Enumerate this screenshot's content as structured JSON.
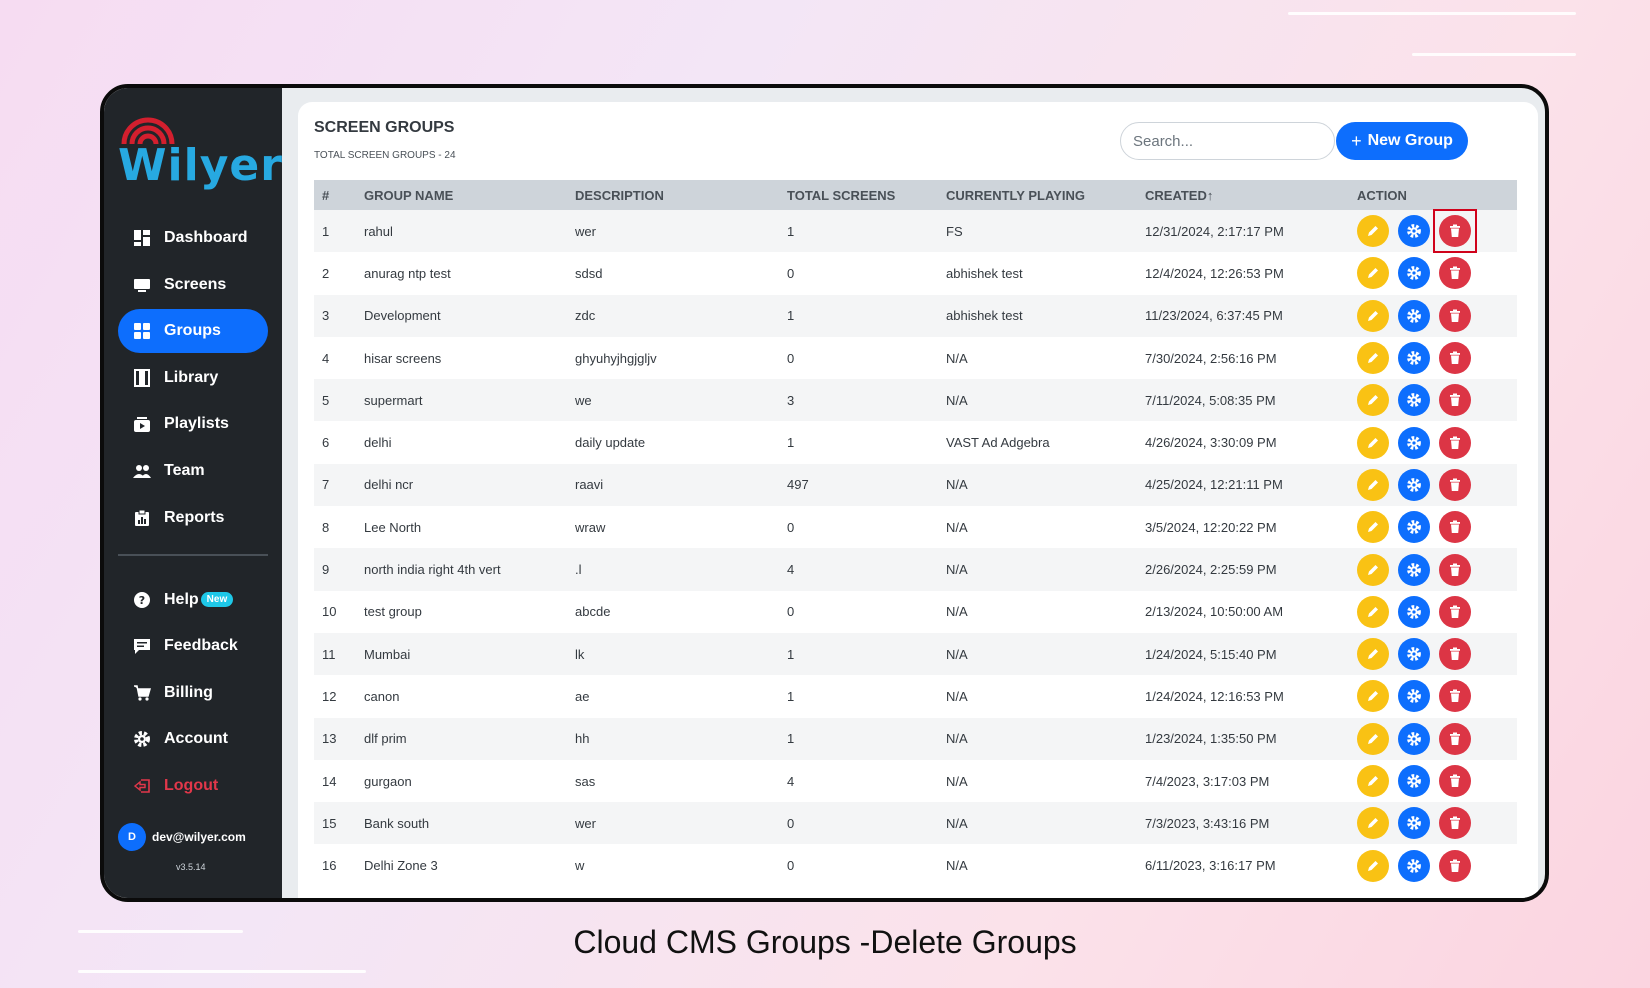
{
  "brand": {
    "name": "Wilyer",
    "logo_color": "#27a9e1",
    "signal_color": "#d31f2e"
  },
  "sidebar": {
    "items": [
      {
        "label": "Dashboard",
        "icon": "dashboard-icon",
        "active": false
      },
      {
        "label": "Screens",
        "icon": "monitor-icon",
        "active": false
      },
      {
        "label": "Groups",
        "icon": "grid-icon",
        "active": true
      },
      {
        "label": "Library",
        "icon": "film-icon",
        "active": false
      },
      {
        "label": "Playlists",
        "icon": "playlist-icon",
        "active": false
      },
      {
        "label": "Team",
        "icon": "team-icon",
        "active": false
      },
      {
        "label": "Reports",
        "icon": "clipboard-icon",
        "active": false
      }
    ],
    "secondary": [
      {
        "label": "Help",
        "icon": "help-icon",
        "badge": "New"
      },
      {
        "label": "Feedback",
        "icon": "feedback-icon"
      },
      {
        "label": "Billing",
        "icon": "cart-icon"
      },
      {
        "label": "Account",
        "icon": "gear-icon"
      },
      {
        "label": "Logout",
        "icon": "logout-icon"
      }
    ],
    "user": {
      "initial": "D",
      "email": "dev@wilyer.com"
    },
    "version": "v3.5.14"
  },
  "main": {
    "title": "SCREEN GROUPS",
    "subtitle": "TOTAL SCREEN GROUPS - 24",
    "search_placeholder": "Search...",
    "new_group_label": "New Group",
    "columns": [
      "#",
      "GROUP NAME",
      "DESCRIPTION",
      "TOTAL SCREENS",
      "CURRENTLY PLAYING",
      "CREATED",
      "ACTION"
    ],
    "sort_indicator": "↑",
    "rows": [
      {
        "num": "1",
        "name": "rahul",
        "desc": "wer",
        "total": "1",
        "playing": "FS",
        "created": "12/31/2024, 2:17:17 PM"
      },
      {
        "num": "2",
        "name": "anurag ntp test",
        "desc": "sdsd",
        "total": "0",
        "playing": "abhishek test",
        "created": "12/4/2024, 12:26:53 PM"
      },
      {
        "num": "3",
        "name": "Development",
        "desc": "zdc",
        "total": "1",
        "playing": "abhishek test",
        "created": "11/23/2024, 6:37:45 PM"
      },
      {
        "num": "4",
        "name": "hisar screens",
        "desc": "ghyuhyjhgjgljv",
        "total": "0",
        "playing": "N/A",
        "created": "7/30/2024, 2:56:16 PM"
      },
      {
        "num": "5",
        "name": "supermart",
        "desc": "we",
        "total": "3",
        "playing": "N/A",
        "created": "7/11/2024, 5:08:35 PM"
      },
      {
        "num": "6",
        "name": "delhi",
        "desc": "daily update",
        "total": "1",
        "playing": "VAST Ad Adgebra",
        "created": "4/26/2024, 3:30:09 PM"
      },
      {
        "num": "7",
        "name": "delhi ncr",
        "desc": "raavi",
        "total": "497",
        "playing": "N/A",
        "created": "4/25/2024, 12:21:11 PM"
      },
      {
        "num": "8",
        "name": "Lee North",
        "desc": "wraw",
        "total": "0",
        "playing": "N/A",
        "created": "3/5/2024, 12:20:22 PM"
      },
      {
        "num": "9",
        "name": "north india right 4th vert",
        "desc": ".l",
        "total": "4",
        "playing": "N/A",
        "created": "2/26/2024, 2:25:59 PM"
      },
      {
        "num": "10",
        "name": "test group",
        "desc": "abcde",
        "total": "0",
        "playing": "N/A",
        "created": "2/13/2024, 10:50:00 AM"
      },
      {
        "num": "11",
        "name": "Mumbai",
        "desc": "lk",
        "total": "1",
        "playing": "N/A",
        "created": "1/24/2024, 5:15:40 PM"
      },
      {
        "num": "12",
        "name": "canon",
        "desc": "ae",
        "total": "1",
        "playing": "N/A",
        "created": "1/24/2024, 12:16:53 PM"
      },
      {
        "num": "13",
        "name": "dlf prim",
        "desc": "hh",
        "total": "1",
        "playing": "N/A",
        "created": "1/23/2024, 1:35:50 PM"
      },
      {
        "num": "14",
        "name": "gurgaon",
        "desc": "sas",
        "total": "4",
        "playing": "N/A",
        "created": "7/4/2023, 3:17:03 PM"
      },
      {
        "num": "15",
        "name": "Bank south",
        "desc": "wer",
        "total": "0",
        "playing": "N/A",
        "created": "7/3/2023, 3:43:16 PM"
      },
      {
        "num": "16",
        "name": "Delhi Zone 3",
        "desc": "w",
        "total": "0",
        "playing": "N/A",
        "created": "6/11/2023, 3:16:17 PM"
      }
    ],
    "action_icons": [
      "pencil-icon",
      "gear-icon",
      "trash-icon"
    ],
    "colors": {
      "edit": "#f9c214",
      "settings": "#0d6efd",
      "delete": "#dc3545",
      "highlight": "#d0021b"
    }
  },
  "caption": "Cloud CMS Groups -Delete Groups"
}
